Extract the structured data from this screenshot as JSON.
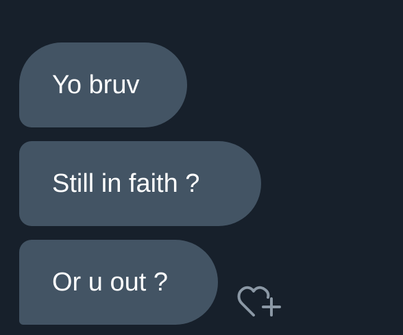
{
  "messages": [
    {
      "text": "Yo bruv"
    },
    {
      "text": "Still in faith ?"
    },
    {
      "text": "Or u out ?"
    }
  ],
  "reaction_button": {
    "icon": "heart-plus-icon"
  },
  "colors": {
    "background": "#17202b",
    "bubble": "#435464",
    "text": "#ffffff",
    "icon": "#8b98a5"
  }
}
